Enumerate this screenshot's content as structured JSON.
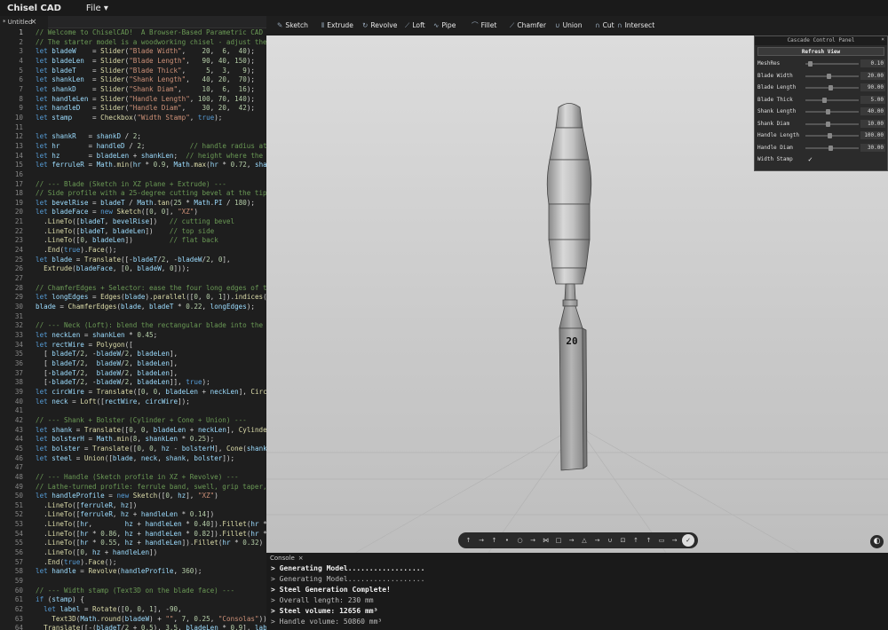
{
  "app": {
    "title": "Chisel CAD",
    "file_menu": "File"
  },
  "tab": {
    "label": "* Untitled",
    "close": "×"
  },
  "toolbar": {
    "items": [
      "Sketch",
      "Extrude",
      "Revolve",
      "Loft",
      "Pipe",
      "Fillet",
      "Chamfer",
      "Union",
      "Cut",
      "Intersect"
    ]
  },
  "editor": {
    "lines": [
      "// Welcome to ChiselCAD!  A Browser-Based Parametric CAD Environment",
      "// The starter model is a woodworking chisel - adjust the sliders",
      "let bladeW    = Slider(\"Blade Width\",    20,  6,  40);",
      "let bladeLen  = Slider(\"Blade Length\",   90, 40, 150);",
      "let bladeT    = Slider(\"Blade Thick\",     5,  3,   9);",
      "let shankLen  = Slider(\"Shank Length\",   40, 20,  70);",
      "let shankD    = Slider(\"Shank Diam\",     10,  6,  16);",
      "let handleLen = Slider(\"Handle Length\", 100, 70, 140);",
      "let handleD   = Slider(\"Handle Diam\",    30, 20,  42);",
      "let stamp     = Checkbox(\"Width Stamp\", true);",
      "",
      "let shankR   = shankD / 2;",
      "let hr       = handleD / 2;           // handle radius at the",
      "let hz       = bladeLen + shankLen;  // height where the han",
      "let ferruleR = Math.min(hr * 0.9, Math.max(hr * 0.72, shankR",
      "",
      "// --- Blade (Sketch in XZ plane + Extrude) ---",
      "// Side profile with a 25-degree cutting bevel at the tip",
      "let bevelRise = bladeT / Math.tan(25 * Math.PI / 180);",
      "let bladeFace = new Sketch([0, 0], \"XZ\")",
      "  .LineTo([bladeT, bevelRise])   // cutting bevel",
      "  .LineTo([bladeT, bladeLen])    // top side",
      "  .LineTo([0, bladeLen])         // flat back",
      "  .End(true).Face();",
      "let blade = Translate([-bladeT/2, -bladeW/2, 0],",
      "  Extrude(bladeFace, [0, bladeW, 0]));",
      "",
      "// ChamferEdges + Selector: ease the four long edges of the",
      "let longEdges = Edges(blade).parallel([0, 0, 1]).indices();",
      "blade = ChamferEdges(blade, bladeT * 0.22, longEdges);",
      "",
      "// --- Neck (Loft): blend the rectangular blade into the rou",
      "let neckLen = shankLen * 0.45;",
      "let rectWire = Polygon([",
      "  [ bladeT/2, -bladeW/2, bladeLen],",
      "  [ bladeT/2,  bladeW/2, bladeLen],",
      "  [-bladeT/2,  bladeW/2, bladeLen],",
      "  [-bladeT/2, -bladeW/2, bladeLen]], true);",
      "let circWire = Translate([0, 0, bladeLen + neckLen], Circle(",
      "let neck = Loft([rectWire, circWire]);",
      "",
      "// --- Shank + Bolster (Cylinder + Cone + Union) ---",
      "let shank = Translate([0, 0, bladeLen + neckLen], Cylinder(s",
      "let bolsterH = Math.min(8, shankLen * 0.25);",
      "let bolster = Translate([0, 0, hz - bolsterH], Cone(shankR,",
      "let steel = Union([blade, neck, shank, bolster]);",
      "",
      "// --- Handle (Sketch profile in XZ + Revolve) ---",
      "// Lathe-turned profile: ferrule band, swell, grip taper, ro",
      "let handleProfile = new Sketch([0, hz], \"XZ\")",
      "  .LineTo([ferruleR, hz])",
      "  .LineTo([ferruleR, hz + handleLen * 0.14])",
      "  .LineTo([hr,        hz + handleLen * 0.40]).Fillet(hr * 0.",
      "  .LineTo([hr * 0.86, hz + handleLen * 0.82]).Fillet(hr * 0.",
      "  .LineTo([hr * 0.55, hz + handleLen]).Fillet(hr * 0.32)",
      "  .LineTo([0, hz + handleLen])",
      "  .End(true).Face();",
      "let handle = Revolve(handleProfile, 360);",
      "",
      "// --- Width stamp (Text3D on the blade face) ---",
      "if (stamp) {",
      "  let label = Rotate([0, 0, 1], -90,",
      "    Text3D(Math.round(bladeW) + \"\", 7, 0.25, \"Consolas\"));",
      "  Translate([-(bladeT/2 + 0.5), 3.5, bladeLen * 0.9], label)"
    ]
  },
  "panel": {
    "title": "Cascade Control Panel",
    "close": "×",
    "refresh": "Refresh View",
    "params": [
      {
        "label": "MeshRes",
        "value": "0.10",
        "fraction": 0.05
      },
      {
        "label": "Blade Width",
        "value": "20.00",
        "fraction": 0.41
      },
      {
        "label": "Blade Length",
        "value": "90.00",
        "fraction": 0.45
      },
      {
        "label": "Blade Thick",
        "value": "5.00",
        "fraction": 0.33
      },
      {
        "label": "Shank Length",
        "value": "40.00",
        "fraction": 0.4
      },
      {
        "label": "Shank Diam",
        "value": "10.00",
        "fraction": 0.4
      },
      {
        "label": "Handle Length",
        "value": "100.00",
        "fraction": 0.43
      },
      {
        "label": "Handle Diam",
        "value": "30.00",
        "fraction": 0.45
      }
    ],
    "checkbox": {
      "label": "Width Stamp",
      "checked": "✓"
    }
  },
  "model": {
    "stamp_text": "20"
  },
  "console": {
    "title": "Console",
    "close": "×",
    "lines": [
      "> Generating Model..................",
      "> Generating Model..................",
      "> Steel Generation Complete!",
      "> Overall length: 230 mm",
      "> Steel volume: 12656 mm³",
      "> Handle volume: 50860 mm³"
    ]
  },
  "colors": {
    "accent": "#569cd6",
    "viewport_bg": "#d0d0d0",
    "panel_bg": "#2b2b2b"
  }
}
